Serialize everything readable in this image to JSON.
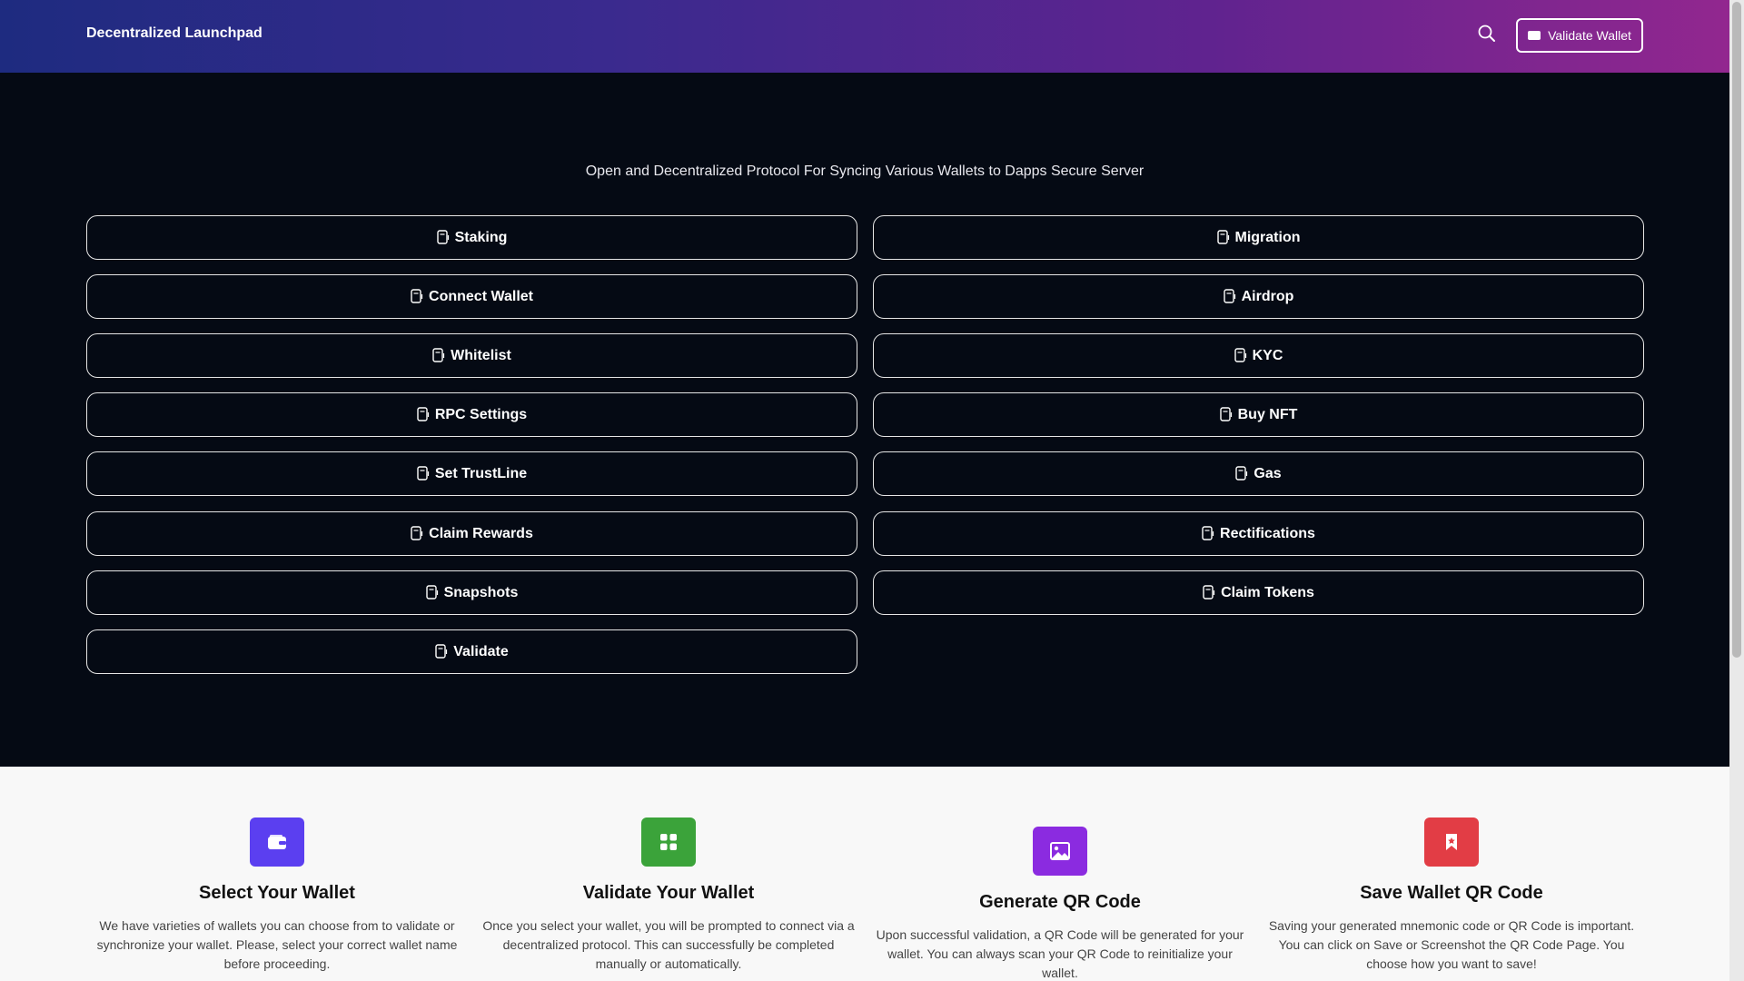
{
  "header": {
    "brand": "Decentralized Launchpad",
    "validate_button": "Validate Wallet",
    "search_icon": "search-icon",
    "wallet_icon": "wallet-icon"
  },
  "hero": {
    "tagline": "Open and Decentralized Protocol For Syncing Various Wallets to Dapps Secure Server"
  },
  "options": {
    "left": [
      "Staking",
      "Connect Wallet",
      "Whitelist",
      "RPC Settings",
      "Set TrustLine",
      "Claim Rewards",
      "Snapshots",
      "Validate"
    ],
    "right": [
      "Migration",
      "Airdrop",
      "KYC",
      "Buy NFT",
      "Gas",
      "Rectifications",
      "Claim Tokens"
    ]
  },
  "features": [
    {
      "title": "Select Your Wallet",
      "text": "We have varieties of wallets you can choose from to validate or synchronize your wallet. Please, select your correct wallet name before proceeding.",
      "icon": "wallet-icon",
      "color": "#5b3ff0"
    },
    {
      "title": "Validate Your Wallet",
      "text": "Once you select your wallet, you will be prompted to connect via a decentralized protocol. This can successfully be completed manually or automatically.",
      "icon": "grid-icon",
      "color": "#3ba33a"
    },
    {
      "title": "Generate QR Code",
      "text": "Upon successful validation, a QR Code will be generated for your wallet. You can always scan your QR Code to reinitialize your wallet.",
      "icon": "image-icon",
      "color": "#8b2be0"
    },
    {
      "title": "Save Wallet QR Code",
      "text": "Saving your generated mnemonic code or QR Code is important. You can click on Save or Screenshot the QR Code Page. You choose how you want to save!",
      "icon": "bookmark-icon",
      "color": "#e23d45"
    }
  ],
  "colors": {
    "background": "#050a14",
    "header_gradient_start": "#1e2b80",
    "header_gradient_end": "#92278f",
    "features_background": "#f8f8f8"
  }
}
